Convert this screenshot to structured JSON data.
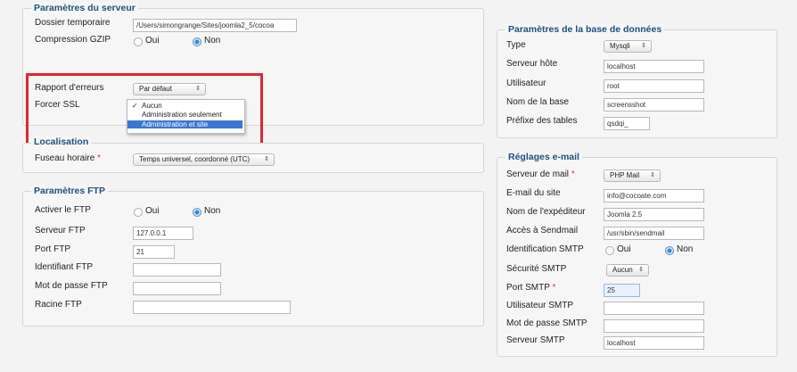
{
  "server": {
    "title": "Paramètres du serveur",
    "temp_dir_label": "Dossier temporaire",
    "temp_dir_value": "/Users/simongrange/Sites/joomla2_5/cocoa",
    "gzip_label": "Compression GZIP",
    "gzip_yes": "Oui",
    "gzip_no": "Non",
    "errors_label": "Rapport d'erreurs",
    "errors_value": "Par défaut",
    "ssl_label": "Forcer SSL",
    "ssl_options": [
      "Aucun",
      "Administration seulement",
      "Administration et site"
    ],
    "ssl_checkmark": "✓"
  },
  "locale": {
    "title": "Localisation",
    "tz_label": "Fuseau horaire",
    "tz_required": "*",
    "tz_value": "Temps universel, coordonné (UTC)"
  },
  "ftp": {
    "title": "Paramètres FTP",
    "enable_label": "Activer le FTP",
    "enable_yes": "Oui",
    "enable_no": "Non",
    "server_label": "Serveur FTP",
    "server_value": "127.0.0.1",
    "port_label": "Port FTP",
    "port_value": "21",
    "user_label": "Identifiant FTP",
    "user_value": "",
    "pass_label": "Mot de passe FTP",
    "pass_value": "",
    "root_label": "Racine FTP",
    "root_value": ""
  },
  "db": {
    "title": "Paramètres de la base de données",
    "type_label": "Type",
    "type_value": "Mysqli",
    "host_label": "Serveur hôte",
    "host_value": "localhost",
    "user_label": "Utilisateur",
    "user_value": "root",
    "name_label": "Nom de la base",
    "name_value": "screensshot",
    "prefix_label": "Préfixe des tables",
    "prefix_value": "qsdqi_"
  },
  "mail": {
    "title": "Réglages e-mail",
    "server_label": "Serveur de mail",
    "server_required": "*",
    "server_value": "PHP Mail",
    "site_email_label": "E-mail du site",
    "site_email_value": "info@cocoate.com",
    "sender_label": "Nom de l'expéditeur",
    "sender_value": "Joomla 2.5",
    "sendmail_label": "Accès à Sendmail",
    "sendmail_value": "/usr/sbin/sendmail",
    "smtp_auth_label": "Identification SMTP",
    "smtp_auth_yes": "Oui",
    "smtp_auth_no": "Non",
    "smtp_sec_label": "Sécurité SMTP",
    "smtp_sec_value": "Aucun",
    "smtp_port_label": "Port SMTP",
    "smtp_port_required": "*",
    "smtp_port_value": "25",
    "smtp_user_label": "Utilisateur SMTP",
    "smtp_user_value": "",
    "smtp_pass_label": "Mot de passe SMTP",
    "smtp_pass_value": "",
    "smtp_host_label": "Serveur SMTP",
    "smtp_host_value": "localhost"
  },
  "icons": {
    "select_arrow": "select-arrows-icon"
  },
  "colors": {
    "legend": "#1f4f82",
    "highlight": "#e2262f",
    "selected_option": "#3a76d2",
    "required": "#e2353a"
  }
}
